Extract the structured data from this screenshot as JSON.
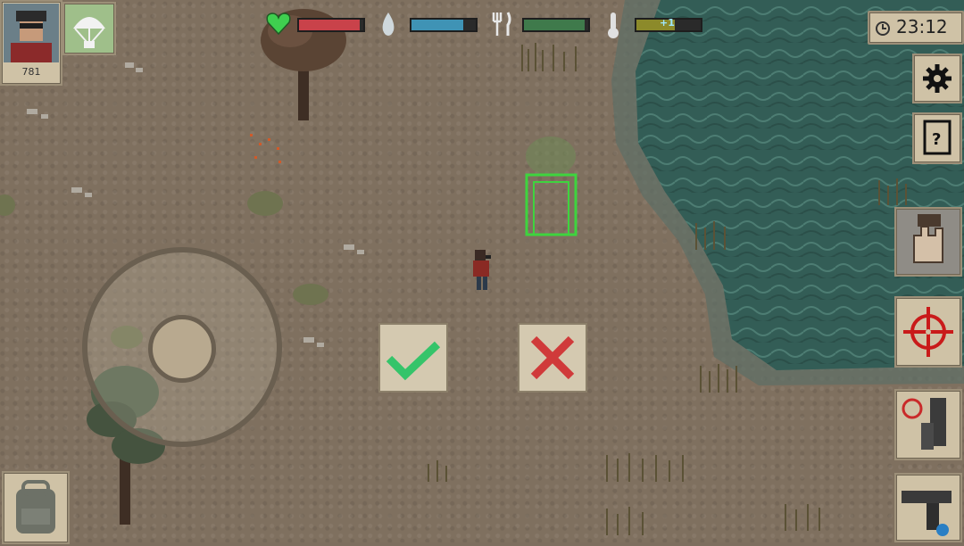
{
  "player": {
    "level": "781"
  },
  "hud": {
    "clock": "23:12",
    "temperature_delta": "+1",
    "health_level": 0.95,
    "thirst_level": 0.8,
    "hunger_level": 0.95,
    "temperature_level": 0.6
  },
  "icons": {
    "avatar": "player-portrait",
    "airdrop": "parachute-icon",
    "health": "heart-icon",
    "thirst": "water-drop-icon",
    "hunger": "fork-knife-icon",
    "temperature": "thermometer-icon",
    "clock": "clock-icon",
    "settings": "gear-icon",
    "quests": "notes-icon",
    "interact": "hand-icon",
    "aim": "crosshair-icon",
    "reload": "magazine-reload-icon",
    "weapon": "pistol-icon",
    "inventory": "backpack-icon",
    "confirm": "checkmark-icon",
    "cancel": "cross-icon"
  },
  "colors": {
    "health": "#c9424a",
    "thirst": "#3f93b5",
    "hunger": "#3f7a4b",
    "temperature": "#8c8a2a",
    "confirm": "#35c46a",
    "cancel": "#d03a3a",
    "placement": "#3ed43e"
  }
}
